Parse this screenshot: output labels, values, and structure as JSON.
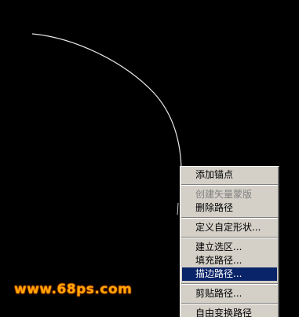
{
  "colors": {
    "background": "#000000",
    "path_stroke": "#e8e8e8",
    "menu_background": "#d4d0c8",
    "menu_highlight": "#0a246a",
    "menu_disabled_text": "#808080",
    "watermark": "#ffa800"
  },
  "context_menu": {
    "items": [
      {
        "label": "添加锚点",
        "state": "normal"
      },
      {
        "separator": true
      },
      {
        "label": "创建矢量蒙版",
        "state": "disabled"
      },
      {
        "label": "删除路径",
        "state": "normal"
      },
      {
        "separator": true
      },
      {
        "label": "定义自定形状...",
        "state": "normal"
      },
      {
        "separator": true
      },
      {
        "label": "建立选区...",
        "state": "normal"
      },
      {
        "label": "填充路径...",
        "state": "normal"
      },
      {
        "label": "描边路径...",
        "state": "highlighted"
      },
      {
        "separator": true
      },
      {
        "label": "剪贴路径...",
        "state": "normal"
      },
      {
        "separator": true
      },
      {
        "label": "自由变换路径",
        "state": "normal"
      }
    ]
  },
  "watermark": {
    "text": "www.68ps.com"
  }
}
